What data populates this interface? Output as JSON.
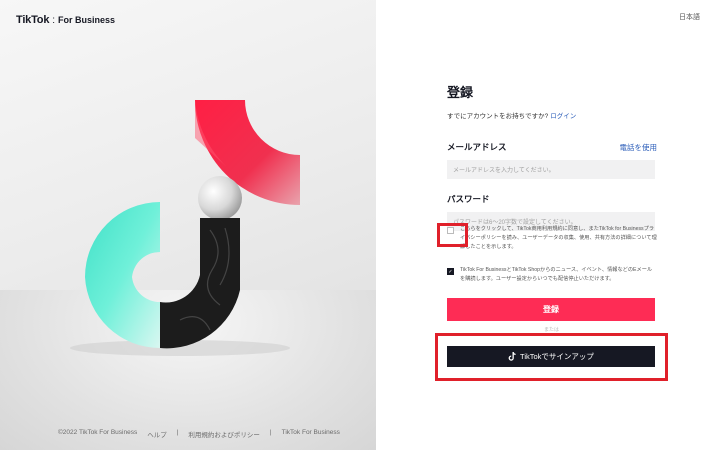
{
  "brand": {
    "logo_main": "TikTok",
    "logo_sub": "For Business"
  },
  "language_label": "日本語",
  "form": {
    "title": "登録",
    "have_account_text": "すでにアカウントをお持ちですか?",
    "login_link": "ログイン",
    "email_label": "メールアドレス",
    "use_phone_link": "電話を使用",
    "email_placeholder": "メールアドレスを入力してください。",
    "password_label": "パスワード",
    "password_placeholder": "パスワードは6〜20字数で設定してください。",
    "terms_text": "こちらをクリックして、TikTok商用利用規約に同意し、またTikTok for Businessプライバシーポリシーを読み、ユーザーデータの収集、使用、共有方法の詳細について理解したことを示します。",
    "terms_checked": false,
    "newsletter_text": "TikTok For BusinessとTikTok Shopからのニュース、イベント、情報などのEメールを購読します。ユーザー設定からいつでも配信停止いただけます。",
    "newsletter_checked": true,
    "signup_button": "登録",
    "or_text": "または",
    "tiktok_signup_button": "TikTokでサインアップ"
  },
  "footer": {
    "copyright": "©2022 TikTok For Business",
    "help": "ヘルプ",
    "terms": "利用規約およびポリシー",
    "brand": "TikTok For Business",
    "separator": "|"
  },
  "colors": {
    "primary": "#fe2c55",
    "dark": "#161823",
    "link": "#2b5db9",
    "highlight": "#e0202a"
  },
  "icons": {
    "tiktok_button_icon": "tiktok-note-icon"
  }
}
